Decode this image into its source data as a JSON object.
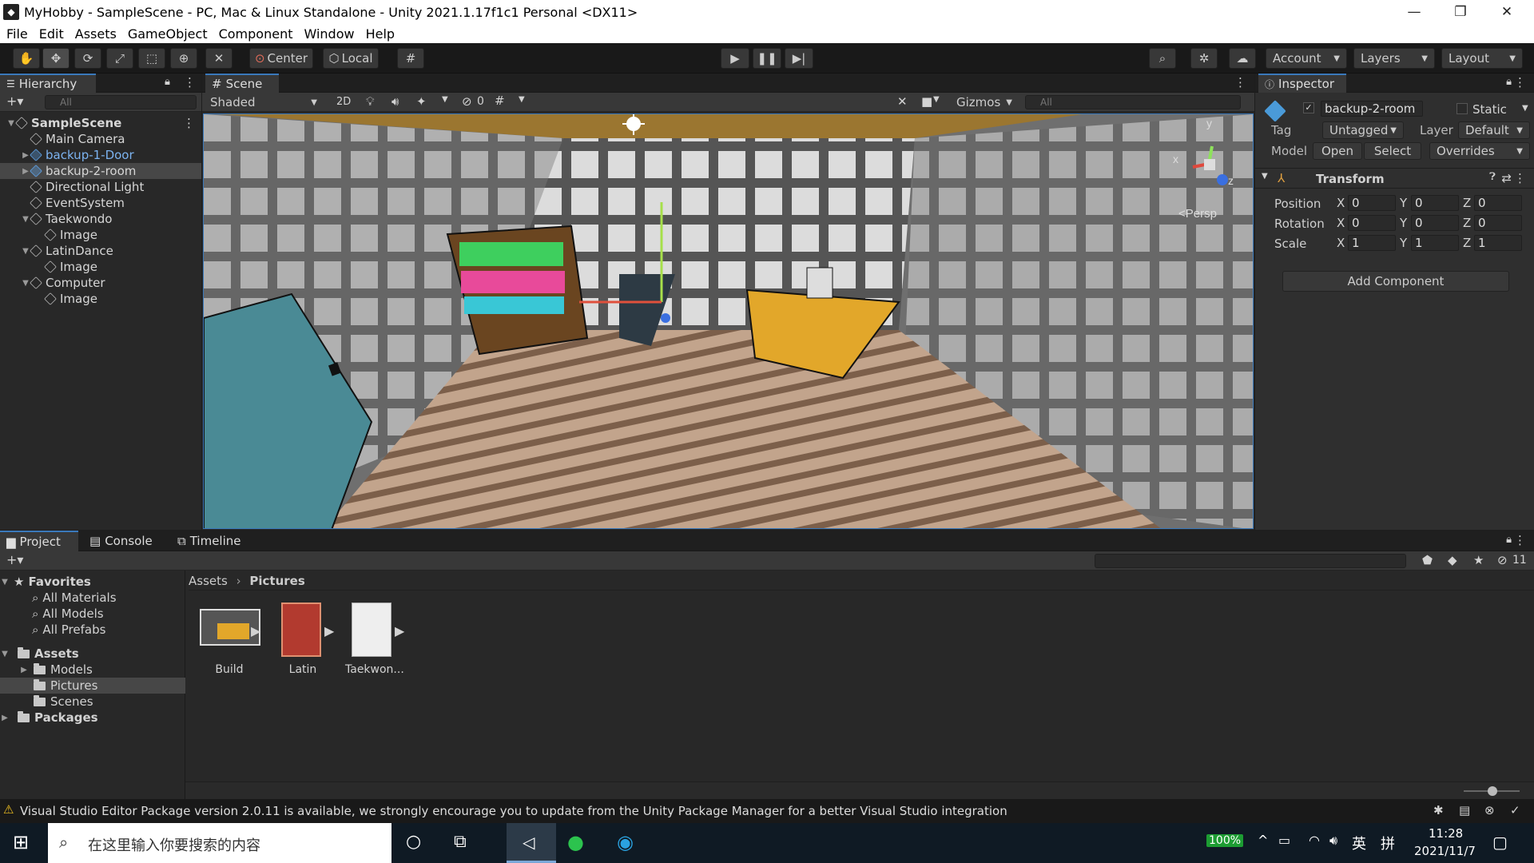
{
  "window": {
    "title": "MyHobby - SampleScene - PC, Mac & Linux Standalone - Unity 2021.1.17f1c1 Personal <DX11>"
  },
  "menu": [
    "File",
    "Edit",
    "Assets",
    "GameObject",
    "Component",
    "Window",
    "Help"
  ],
  "toolbar": {
    "center": "Center",
    "local": "Local",
    "account": "Account",
    "layers": "Layers",
    "layout": "Layout"
  },
  "hierarchy": {
    "tab": "Hierarchy",
    "search_placeholder": "All",
    "items": [
      {
        "label": "SampleScene",
        "depth": 0,
        "expand": "open",
        "icon": "scene",
        "bold": true,
        "selected": false
      },
      {
        "label": "Main Camera",
        "depth": 1,
        "expand": "",
        "icon": "cube",
        "selected": false
      },
      {
        "label": "backup-1-Door",
        "depth": 1,
        "expand": "closed",
        "icon": "prefab",
        "blue": true,
        "selected": false
      },
      {
        "label": "backup-2-room",
        "depth": 1,
        "expand": "closed",
        "icon": "prefab",
        "selected": true
      },
      {
        "label": "Directional Light",
        "depth": 1,
        "expand": "",
        "icon": "cube",
        "selected": false
      },
      {
        "label": "EventSystem",
        "depth": 1,
        "expand": "",
        "icon": "cube",
        "selected": false
      },
      {
        "label": "Taekwondo",
        "depth": 1,
        "expand": "open",
        "icon": "cube",
        "selected": false
      },
      {
        "label": "Image",
        "depth": 2,
        "expand": "",
        "icon": "cube",
        "selected": false
      },
      {
        "label": "LatinDance",
        "depth": 1,
        "expand": "open",
        "icon": "cube",
        "selected": false
      },
      {
        "label": "Image",
        "depth": 2,
        "expand": "",
        "icon": "cube",
        "selected": false
      },
      {
        "label": "Computer",
        "depth": 1,
        "expand": "open",
        "icon": "cube",
        "selected": false
      },
      {
        "label": "Image",
        "depth": 2,
        "expand": "",
        "icon": "cube",
        "selected": false
      }
    ]
  },
  "scene": {
    "tab": "Scene",
    "shading": "Shaded",
    "mode2d": "2D",
    "hidden_count": "0",
    "gizmos": "Gizmos",
    "search_placeholder": "All",
    "persp": "Persp",
    "axis_x": "x",
    "axis_y": "y",
    "axis_z": "z"
  },
  "inspector": {
    "tab": "Inspector",
    "object_name": "backup-2-room",
    "static_label": "Static",
    "tag_label": "Tag",
    "tag_value": "Untagged",
    "layer_label": "Layer",
    "layer_value": "Default",
    "model_label": "Model",
    "open": "Open",
    "select": "Select",
    "overrides": "Overrides",
    "transform": "Transform",
    "position": {
      "label": "Position",
      "x": "0",
      "y": "0",
      "z": "0"
    },
    "rotation": {
      "label": "Rotation",
      "x": "0",
      "y": "0",
      "z": "0"
    },
    "scale": {
      "label": "Scale",
      "x": "1",
      "y": "1",
      "z": "1"
    },
    "add_component": "Add Component"
  },
  "bottom": {
    "tabs": [
      "Project",
      "Console",
      "Timeline"
    ],
    "hidden_count": "11",
    "favorites": {
      "label": "Favorites",
      "items": [
        "All Materials",
        "All Models",
        "All Prefabs"
      ]
    },
    "assets": {
      "label": "Assets",
      "items": [
        "Models",
        "Pictures",
        "Scenes"
      ]
    },
    "packages": "Packages",
    "breadcrumb": [
      "Assets",
      "Pictures"
    ],
    "files": [
      {
        "name": "Build"
      },
      {
        "name": "Latin"
      },
      {
        "name": "Taekwon..."
      }
    ]
  },
  "status": {
    "message": "Visual Studio Editor Package version 2.0.11 is available, we strongly encourage you to update from the Unity Package Manager for a better Visual Studio integration"
  },
  "taskbar": {
    "search_placeholder": "在这里输入你要搜索的内容",
    "battery": "100%",
    "ime": "英",
    "ime2": "拼",
    "time": "11:28",
    "date": "2021/11/7"
  }
}
